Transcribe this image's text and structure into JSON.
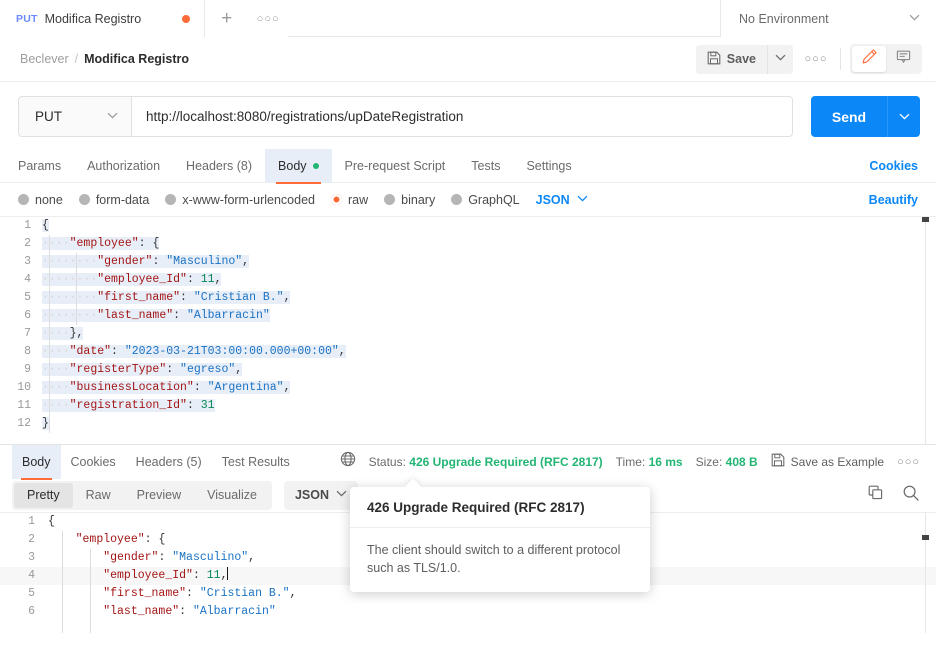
{
  "tabstrip": {
    "request_tab": {
      "method": "PUT",
      "name": "Modifica Registro",
      "unsaved": true
    },
    "new_tab_label": "+",
    "tab_options_label": "○○○",
    "environment": {
      "selected": "No Environment"
    }
  },
  "breadcrumb": {
    "collection": "Beclever",
    "separator": "/",
    "request": "Modifica Registro",
    "save_label": "Save",
    "more_label": "○○○"
  },
  "url_bar": {
    "method": "PUT",
    "url": "http://localhost:8080/registrations/upDateRegistration",
    "send_label": "Send"
  },
  "request_tabs": {
    "items": [
      {
        "label": "Params",
        "selected": false,
        "badge": ""
      },
      {
        "label": "Authorization",
        "selected": false,
        "badge": ""
      },
      {
        "label": "Headers (8)",
        "selected": false,
        "badge": ""
      },
      {
        "label": "Body",
        "selected": true,
        "badge": "dot"
      },
      {
        "label": "Pre-request Script",
        "selected": false,
        "badge": ""
      },
      {
        "label": "Tests",
        "selected": false,
        "badge": ""
      },
      {
        "label": "Settings",
        "selected": false,
        "badge": ""
      }
    ],
    "cookies_label": "Cookies"
  },
  "body_type": {
    "options": [
      {
        "label": "none",
        "selected": false
      },
      {
        "label": "form-data",
        "selected": false
      },
      {
        "label": "x-www-form-urlencoded",
        "selected": false
      },
      {
        "label": "raw",
        "selected": true
      },
      {
        "label": "binary",
        "selected": false
      },
      {
        "label": "GraphQL",
        "selected": false
      }
    ],
    "format": "JSON",
    "beautify_label": "Beautify"
  },
  "request_body": {
    "lines": [
      {
        "n": "1",
        "indent": 0,
        "tokens": [
          {
            "t": "{",
            "c": "p"
          }
        ]
      },
      {
        "n": "2",
        "indent": 1,
        "tokens": [
          {
            "t": "\"employee\"",
            "c": "k"
          },
          {
            "t": ": ",
            "c": "p"
          },
          {
            "t": "{",
            "c": "p"
          }
        ]
      },
      {
        "n": "3",
        "indent": 2,
        "tokens": [
          {
            "t": "\"gender\"",
            "c": "k"
          },
          {
            "t": ": ",
            "c": "p"
          },
          {
            "t": "\"Masculino\"",
            "c": "s"
          },
          {
            "t": ",",
            "c": "p"
          }
        ]
      },
      {
        "n": "4",
        "indent": 2,
        "tokens": [
          {
            "t": "\"employee_Id\"",
            "c": "k"
          },
          {
            "t": ": ",
            "c": "p"
          },
          {
            "t": "11",
            "c": "n"
          },
          {
            "t": ",",
            "c": "p"
          }
        ]
      },
      {
        "n": "5",
        "indent": 2,
        "tokens": [
          {
            "t": "\"first_name\"",
            "c": "k"
          },
          {
            "t": ": ",
            "c": "p"
          },
          {
            "t": "\"Cristian B.\"",
            "c": "s"
          },
          {
            "t": ",",
            "c": "p"
          }
        ]
      },
      {
        "n": "6",
        "indent": 2,
        "tokens": [
          {
            "t": "\"last_name\"",
            "c": "k"
          },
          {
            "t": ": ",
            "c": "p"
          },
          {
            "t": "\"Albarracin\"",
            "c": "s"
          }
        ]
      },
      {
        "n": "7",
        "indent": 1,
        "tokens": [
          {
            "t": "}",
            "c": "p"
          },
          {
            "t": ",",
            "c": "p"
          }
        ]
      },
      {
        "n": "8",
        "indent": 1,
        "tokens": [
          {
            "t": "\"date\"",
            "c": "k"
          },
          {
            "t": ": ",
            "c": "p"
          },
          {
            "t": "\"2023-03-21T03:00:00.000+00:00\"",
            "c": "s"
          },
          {
            "t": ",",
            "c": "p"
          }
        ]
      },
      {
        "n": "9",
        "indent": 1,
        "tokens": [
          {
            "t": "\"registerType\"",
            "c": "k"
          },
          {
            "t": ": ",
            "c": "p"
          },
          {
            "t": "\"egreso\"",
            "c": "s"
          },
          {
            "t": ",",
            "c": "p"
          }
        ]
      },
      {
        "n": "10",
        "indent": 1,
        "tokens": [
          {
            "t": "\"businessLocation\"",
            "c": "k"
          },
          {
            "t": ": ",
            "c": "p"
          },
          {
            "t": "\"Argentina\"",
            "c": "s"
          },
          {
            "t": ",",
            "c": "p"
          }
        ]
      },
      {
        "n": "11",
        "indent": 1,
        "tokens": [
          {
            "t": "\"registration_Id\"",
            "c": "k"
          },
          {
            "t": ": ",
            "c": "p"
          },
          {
            "t": "31",
            "c": "n"
          }
        ]
      },
      {
        "n": "12",
        "indent": 0,
        "tokens": [
          {
            "t": "}",
            "c": "p"
          }
        ]
      }
    ]
  },
  "response": {
    "tabs": [
      {
        "label": "Body",
        "selected": true
      },
      {
        "label": "Cookies",
        "selected": false
      },
      {
        "label": "Headers (5)",
        "selected": false
      },
      {
        "label": "Test Results",
        "selected": false
      }
    ],
    "status_label": "Status:",
    "status_value": "426 Upgrade Required (RFC 2817)",
    "time_label": "Time:",
    "time_value": "16 ms",
    "size_label": "Size:",
    "size_value": "408 B",
    "save_example_label": "Save as Example",
    "more_label": "○○○",
    "view_modes": [
      {
        "label": "Pretty",
        "selected": true
      },
      {
        "label": "Raw",
        "selected": false
      },
      {
        "label": "Preview",
        "selected": false
      },
      {
        "label": "Visualize",
        "selected": false
      }
    ],
    "format": "JSON",
    "body_lines": [
      {
        "n": "1",
        "indent": 0,
        "active": false,
        "tokens": [
          {
            "t": "{",
            "c": "p"
          }
        ]
      },
      {
        "n": "2",
        "indent": 1,
        "active": false,
        "tokens": [
          {
            "t": "\"employee\"",
            "c": "k"
          },
          {
            "t": ": ",
            "c": "p"
          },
          {
            "t": "{",
            "c": "p"
          }
        ]
      },
      {
        "n": "3",
        "indent": 2,
        "active": false,
        "tokens": [
          {
            "t": "\"gender\"",
            "c": "k"
          },
          {
            "t": ": ",
            "c": "p"
          },
          {
            "t": "\"Masculino\"",
            "c": "s"
          },
          {
            "t": ",",
            "c": "p"
          }
        ]
      },
      {
        "n": "4",
        "indent": 2,
        "active": true,
        "tokens": [
          {
            "t": "\"employee_Id\"",
            "c": "k"
          },
          {
            "t": ": ",
            "c": "p"
          },
          {
            "t": "11",
            "c": "n"
          },
          {
            "t": ",",
            "c": "p"
          }
        ]
      },
      {
        "n": "5",
        "indent": 2,
        "active": false,
        "tokens": [
          {
            "t": "\"first_name\"",
            "c": "k"
          },
          {
            "t": ": ",
            "c": "p"
          },
          {
            "t": "\"Cristian B.\"",
            "c": "s"
          },
          {
            "t": ",",
            "c": "p"
          }
        ]
      },
      {
        "n": "6",
        "indent": 2,
        "active": false,
        "tokens": [
          {
            "t": "\"last_name\"",
            "c": "k"
          },
          {
            "t": ": ",
            "c": "p"
          },
          {
            "t": "\"Albarracin\"",
            "c": "s"
          }
        ]
      }
    ]
  },
  "tooltip": {
    "title": "426 Upgrade Required (RFC 2817)",
    "text": "The client should switch to a different protocol such as TLS/1.0."
  },
  "colors": {
    "accent_orange": "#ff6c37",
    "link_blue": "#0b87f7",
    "status_green": "#22b573",
    "method_blue": "#6b8afd"
  }
}
